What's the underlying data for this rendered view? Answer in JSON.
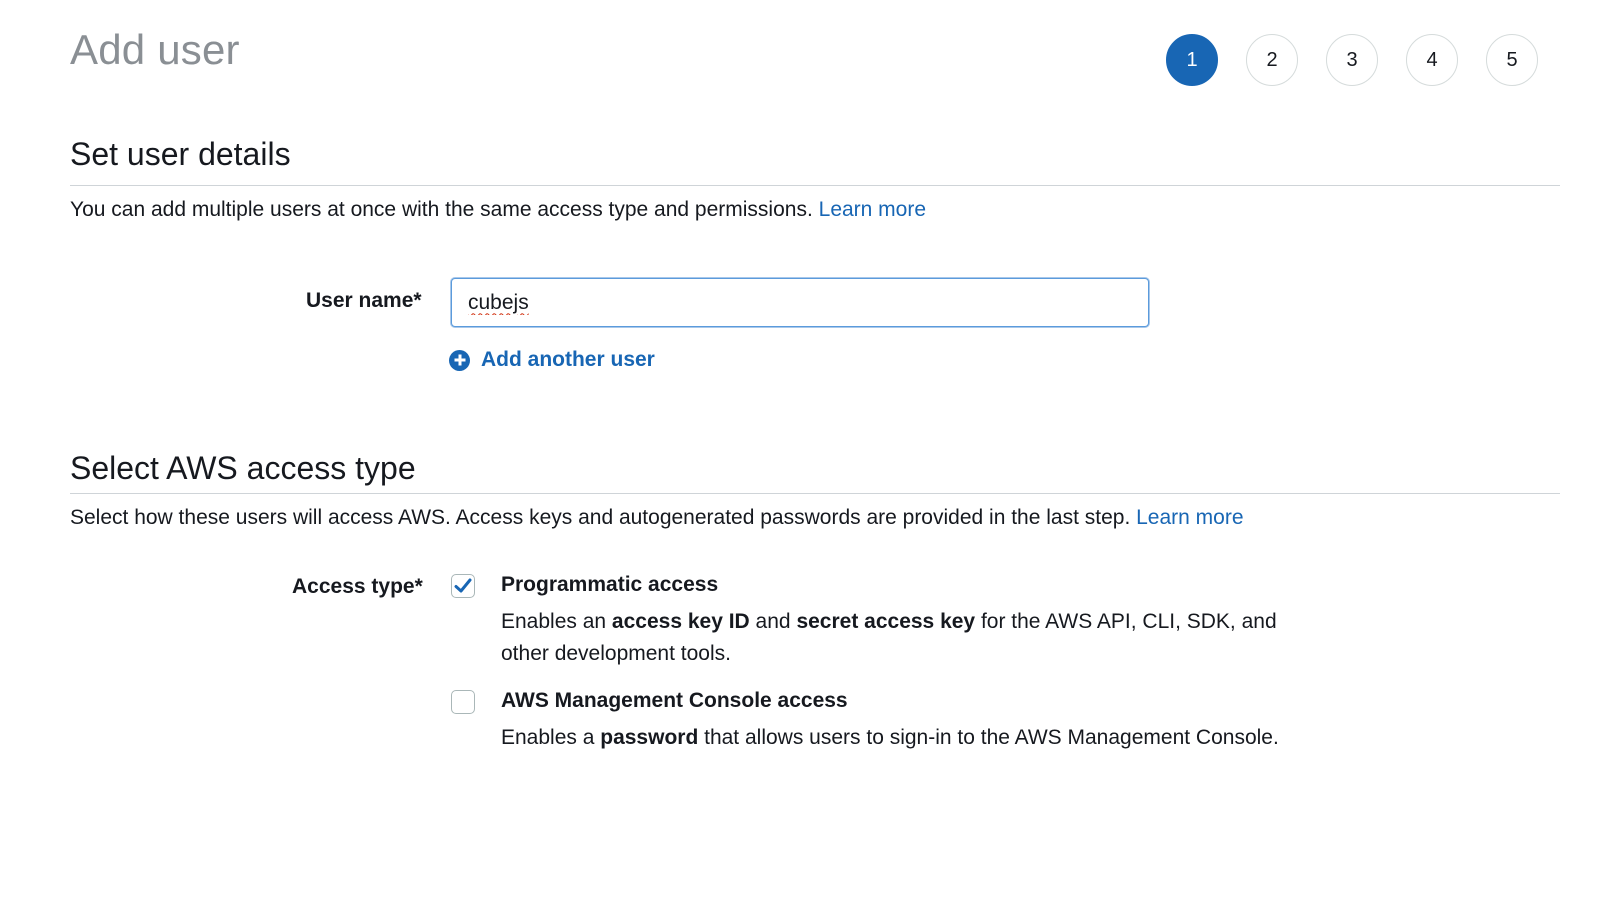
{
  "header": {
    "title": "Add user",
    "steps": [
      {
        "label": "1",
        "active": true
      },
      {
        "label": "2",
        "active": false
      },
      {
        "label": "3",
        "active": false
      },
      {
        "label": "4",
        "active": false
      },
      {
        "label": "5",
        "active": false
      }
    ]
  },
  "user_details": {
    "title": "Set user details",
    "description": "You can add multiple users at once with the same access type and permissions.",
    "learn_more": "Learn more",
    "username_label": "User name*",
    "username_value": "cubejs",
    "add_another_user": "Add another user"
  },
  "access_type": {
    "title": "Select AWS access type",
    "description": "Select how these users will access AWS. Access keys and autogenerated passwords are provided in the last step.",
    "learn_more": "Learn more",
    "label": "Access type*",
    "options": [
      {
        "title": "Programmatic access",
        "checked": true,
        "desc_1": "Enables an ",
        "desc_bold_1": "access key ID",
        "desc_2": " and ",
        "desc_bold_2": "secret access key",
        "desc_3": " for the AWS API, CLI, SDK, and other development tools."
      },
      {
        "title": "AWS Management Console access",
        "checked": false,
        "desc_1": "Enables a ",
        "desc_bold_1": "password",
        "desc_2": " that allows users to sign-in to the AWS Management Console."
      }
    ]
  },
  "colors": {
    "accent": "#1866b4",
    "title_gray": "#8a8f94",
    "text": "#16191f",
    "divider": "#cfd4d8"
  },
  "icons": {
    "add": "plus-circle-icon",
    "check": "checkmark-icon"
  }
}
